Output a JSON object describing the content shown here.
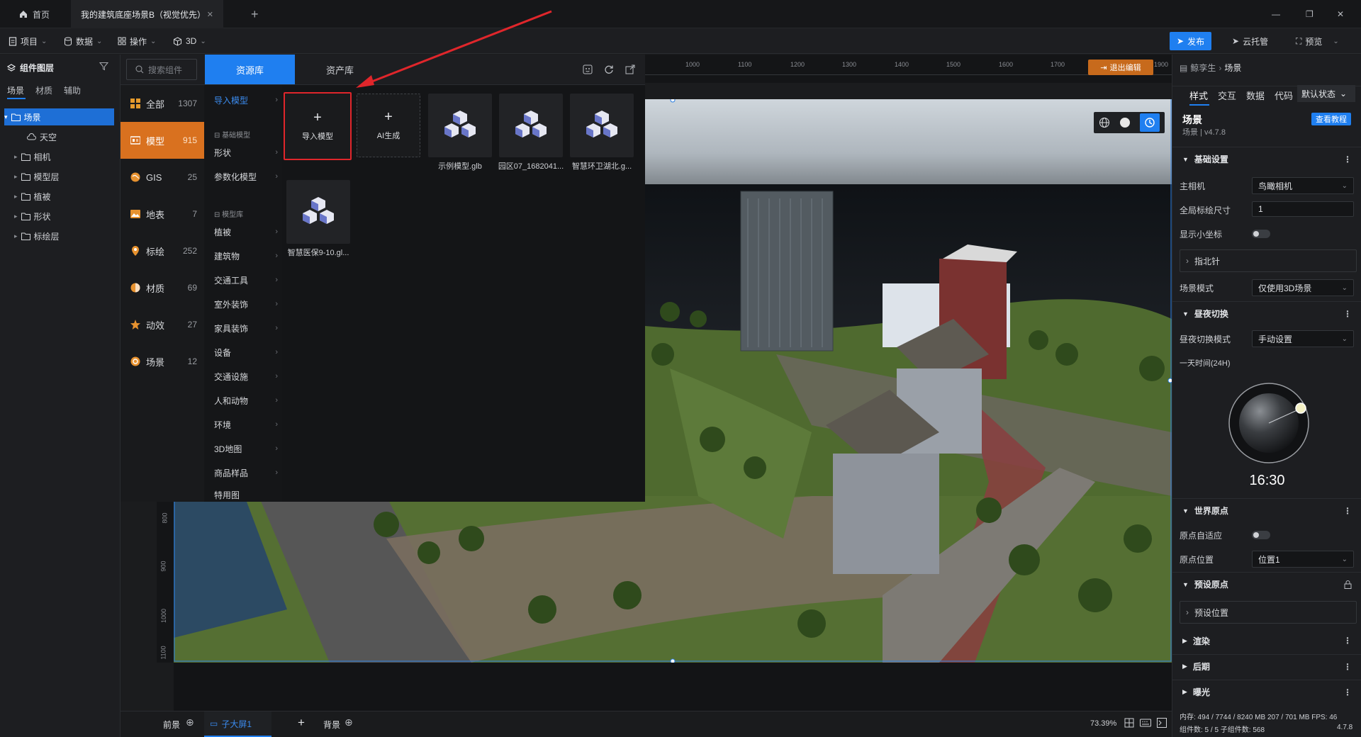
{
  "tabs": {
    "home": "首页",
    "scene_tab": "我的建筑底座场景B（视觉优先）",
    "add": "+"
  },
  "window": {
    "minimize": "—",
    "restore": "❐",
    "close": "✕"
  },
  "toolbar": {
    "project": "项目",
    "data": "数据",
    "operate": "操作",
    "mode3d": "3D",
    "publish": "发布",
    "cloud": "云托管",
    "preview": "预览"
  },
  "layers": {
    "title": "组件图层",
    "tabs": [
      "场景",
      "材质",
      "辅助"
    ],
    "tree": [
      "场景",
      "天空",
      "相机",
      "模型层",
      "植被",
      "形状",
      "标绘层"
    ]
  },
  "resource": {
    "search_placeholder": "搜索组件",
    "tab_library": "资源库",
    "tab_assets": "资产库",
    "categories": [
      {
        "name": "全部",
        "count": "1307",
        "icon": "grid-icon"
      },
      {
        "name": "模型",
        "count": "915",
        "icon": "model-icon"
      },
      {
        "name": "GIS",
        "count": "25",
        "icon": "globe-icon"
      },
      {
        "name": "地表",
        "count": "7",
        "icon": "terrain-icon"
      },
      {
        "name": "标绘",
        "count": "252",
        "icon": "pin-icon"
      },
      {
        "name": "材质",
        "count": "69",
        "icon": "material-icon"
      },
      {
        "name": "动效",
        "count": "27",
        "icon": "effect-icon"
      },
      {
        "name": "场景",
        "count": "12",
        "icon": "scene-icon"
      }
    ],
    "sub_import": "导入模型",
    "sub_base_header": "基础模型",
    "sub_base": [
      "形状",
      "参数化模型"
    ],
    "sub_lib_header": "模型库",
    "sub_lib": [
      "植被",
      "建筑物",
      "交通工具",
      "室外装饰",
      "家具装饰",
      "设备",
      "交通设施",
      "人和动物",
      "环境",
      "3D地图",
      "商品样品",
      "特用图"
    ],
    "tiles": {
      "import": "导入模型",
      "ai": "AI生成",
      "items": [
        "示例模型.glb",
        "园区07_1682041...",
        "智慧环卫湖北.g...",
        "智慧医保9-10.gl..."
      ]
    }
  },
  "ruler": {
    "top": [
      "1000",
      "1100",
      "1200",
      "1300",
      "1400",
      "1500",
      "1600",
      "1700",
      "1900"
    ],
    "left": [
      "800",
      "900",
      "1000",
      "1100"
    ]
  },
  "viewport": {
    "exit_edit": "退出编辑"
  },
  "right": {
    "breadcrumb": {
      "root": "鲸孪生",
      "current": "场景"
    },
    "tabs": [
      "样式",
      "交互",
      "数据",
      "代码"
    ],
    "state": "默认状态",
    "title": "场景",
    "subtitle": "场景 | v4.7.8",
    "tutorial": "查看教程",
    "sections": {
      "basic": "基础设置",
      "day": "昼夜切换",
      "origin": "世界原点",
      "preset": "预设原点",
      "render": "渲染",
      "post": "后期",
      "glow": "曝光"
    },
    "props": {
      "main_camera": "主相机",
      "main_camera_val": "鸟瞰相机",
      "global_scale": "全局标绘尺寸",
      "global_scale_val": "1",
      "show_axis": "显示小坐标",
      "compass": "指北针",
      "scene_mode": "场景模式",
      "scene_mode_val": "仅使用3D场景",
      "day_mode": "昼夜切换模式",
      "day_mode_val": "手动设置",
      "day_time": "一天时间(24H)",
      "time": "16:30",
      "origin_adapt": "原点自适应",
      "origin_pos": "原点位置",
      "origin_pos_val": "位置1",
      "preset_pos": "预设位置"
    },
    "stats": {
      "memory": "内存:  494 / 7744 / 8240 MB  207 / 701 MB  FPS:  46",
      "components": "组件数: 5 / 5    子组件数: 568",
      "version": "4.7.8"
    }
  },
  "bottom": {
    "front": "前景",
    "child": "子大屏1",
    "back": "背景",
    "zoom": "73.39%"
  },
  "colors": {
    "accent": "#1f7ff0",
    "selected_category": "#d9711f",
    "highlight_box": "#e0262b",
    "exit_button": "#c76a1c"
  }
}
